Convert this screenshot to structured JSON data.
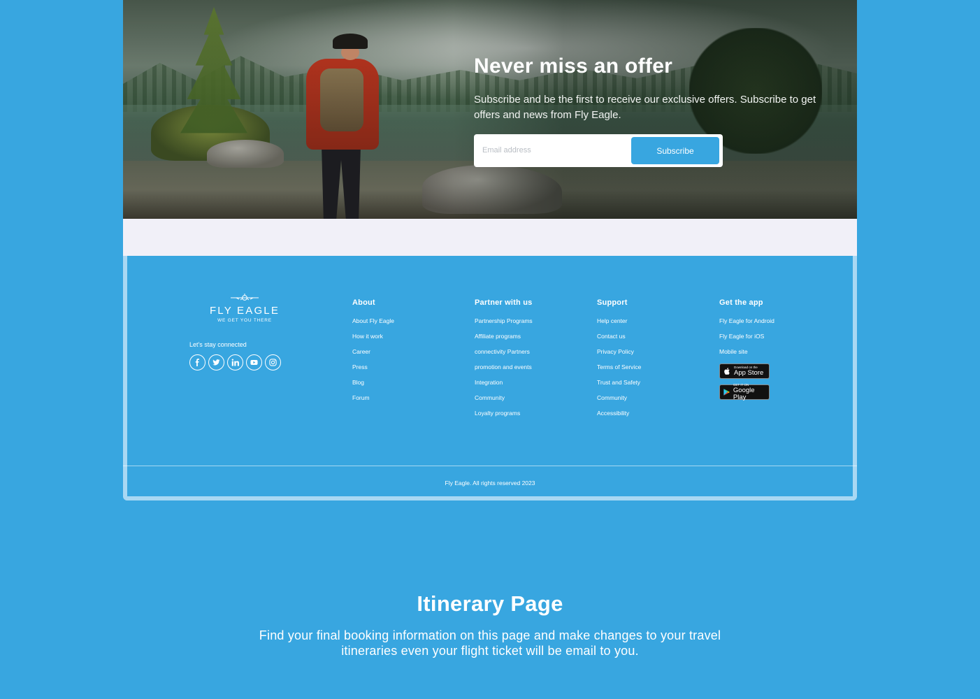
{
  "newsletter": {
    "title": "Never miss an offer",
    "subtitle": "Subscribe and be the first to receive our exclusive offers. Subscribe to get offers and news from Fly Eagle.",
    "email_placeholder": "Email address",
    "subscribe_label": "Subscribe"
  },
  "brand": {
    "name": "FLY EAGLE",
    "tagline": "WE GET YOU THERE",
    "connect_label": "Let's stay connected",
    "socials": [
      "facebook-icon",
      "twitter-icon",
      "linkedin-icon",
      "youtube-icon",
      "instagram-icon"
    ]
  },
  "footer": {
    "columns": [
      {
        "heading": "About",
        "links": [
          "About Fly Eagle",
          "How it work",
          "Career",
          "Press",
          "Blog",
          "Forum"
        ]
      },
      {
        "heading": "Partner with us",
        "links": [
          "Partnership Programs",
          "Affiliate programs",
          "connectivity Partners",
          "promotion and events",
          "Integration",
          "Community",
          "Loyalty programs"
        ]
      },
      {
        "heading": "Support",
        "links": [
          "Help center",
          "Contact us",
          "Privacy Policy",
          "Terms of Service",
          "Trust and Safety",
          "Community",
          "Accessibility"
        ]
      },
      {
        "heading": "Get the app",
        "links": [
          "Fly Eagle for Android",
          "Fly Eagle for iOS",
          "Mobile site"
        ]
      }
    ],
    "app_store": {
      "small": "Download on the",
      "big": "App Store"
    },
    "google_play": {
      "small": "GET IT ON",
      "big": "Google Play"
    },
    "copyright": "Fly Eagle. All rights reserved 2023"
  },
  "section": {
    "title": "Itinerary Page",
    "description": "Find your final booking information on this page and make changes to your travel itineraries even your flight ticket will be email to you."
  },
  "colors": {
    "accent": "#38a6e0",
    "band": "#f1f0f8"
  }
}
